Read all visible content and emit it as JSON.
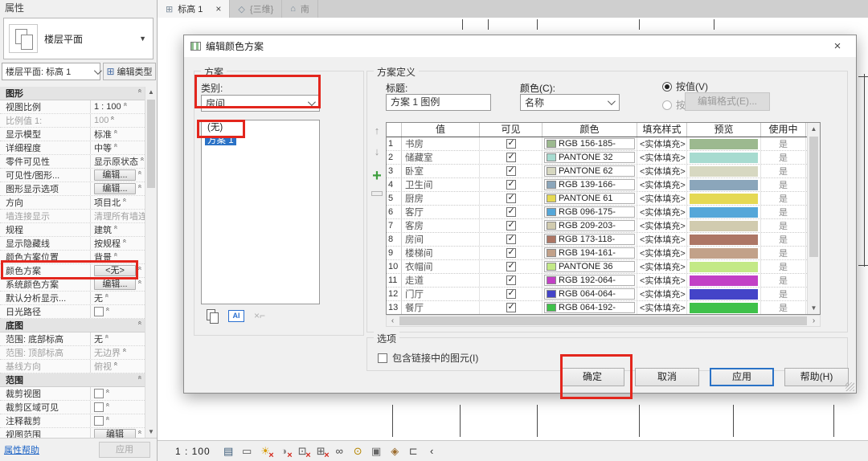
{
  "tabs": [
    {
      "label": "标高 1",
      "glyph": "⊞",
      "active": true
    },
    {
      "label": "{三维}",
      "glyph": "◇",
      "active": false
    },
    {
      "label": "南",
      "glyph": "⌂",
      "active": false
    }
  ],
  "properties": {
    "title": "属性",
    "type_name": "楼层平面",
    "instance": "楼层平面: 标高 1",
    "edit_type": "编辑类型",
    "rows": [
      {
        "label": "图形",
        "value": "",
        "kind": "section"
      },
      {
        "label": "视图比例",
        "value": "1 : 100",
        "kind": "text"
      },
      {
        "label": "比例值 1:",
        "value": "100",
        "kind": "text mute"
      },
      {
        "label": "显示模型",
        "value": "标准",
        "kind": "text"
      },
      {
        "label": "详细程度",
        "value": "中等",
        "kind": "text"
      },
      {
        "label": "零件可见性",
        "value": "显示原状态",
        "kind": "text"
      },
      {
        "label": "可见性/图形...",
        "value": "编辑...",
        "kind": "button"
      },
      {
        "label": "图形显示选项",
        "value": "编辑...",
        "kind": "button"
      },
      {
        "label": "方向",
        "value": "项目北",
        "kind": "text"
      },
      {
        "label": "墙连接显示",
        "value": "清理所有墙连接",
        "kind": "text mute"
      },
      {
        "label": "规程",
        "value": "建筑",
        "kind": "text"
      },
      {
        "label": "显示隐藏线",
        "value": "按规程",
        "kind": "text"
      },
      {
        "label": "颜色方案位置",
        "value": "背景",
        "kind": "text"
      },
      {
        "label": "颜色方案",
        "value": "<无>",
        "kind": "button hl"
      },
      {
        "label": "系统颜色方案",
        "value": "编辑...",
        "kind": "button"
      },
      {
        "label": "默认分析显示...",
        "value": "无",
        "kind": "text"
      },
      {
        "label": "日光路径",
        "value": "",
        "kind": "check"
      },
      {
        "label": "底图",
        "value": "",
        "kind": "section"
      },
      {
        "label": "范围: 底部标高",
        "value": "无",
        "kind": "text"
      },
      {
        "label": "范围: 顶部标高",
        "value": "无边界",
        "kind": "text mute"
      },
      {
        "label": "基线方向",
        "value": "俯视",
        "kind": "text mute"
      },
      {
        "label": "范围",
        "value": "",
        "kind": "section"
      },
      {
        "label": "裁剪视图",
        "value": "",
        "kind": "check"
      },
      {
        "label": "裁剪区域可见",
        "value": "",
        "kind": "check"
      },
      {
        "label": "注释裁剪",
        "value": "",
        "kind": "check"
      },
      {
        "label": "视图范围",
        "value": "编辑",
        "kind": "button"
      }
    ],
    "help_link": "属性帮助",
    "apply_label": "应用"
  },
  "dialog": {
    "title": "编辑颜色方案",
    "scheme": {
      "group_label": "方案",
      "category_label": "类别:",
      "category_value": "房间",
      "list": [
        {
          "label": "(无)",
          "selected": false
        },
        {
          "label": "方案 1",
          "selected": true
        }
      ]
    },
    "definition": {
      "group_label": "方案定义",
      "title_label": "标题:",
      "title_value": "方案 1 图例",
      "color_label": "颜色(C):",
      "color_value": "名称",
      "by_value_label": "按值(V)",
      "by_range_label": "按范围(G)",
      "edit_format_label": "编辑格式(E)..."
    },
    "table": {
      "headers": {
        "num": "",
        "value": "值",
        "visible": "可见",
        "color": "颜色",
        "fill": "填充样式",
        "preview": "预览",
        "in_use": "使用中"
      },
      "rows": [
        {
          "num": "1",
          "value": "书房",
          "color": "RGB 156-185-",
          "fill": "<实体填充>",
          "in_use": "是",
          "hex": "#9cb98f"
        },
        {
          "num": "2",
          "value": "储藏室",
          "color": "PANTONE 32",
          "fill": "<实体填充>",
          "in_use": "是",
          "hex": "#a7dbd0"
        },
        {
          "num": "3",
          "value": "卧室",
          "color": "PANTONE 62",
          "fill": "<实体填充>",
          "in_use": "是",
          "hex": "#d7d8c1"
        },
        {
          "num": "4",
          "value": "卫生间",
          "color": "RGB 139-166-",
          "fill": "<实体填充>",
          "in_use": "是",
          "hex": "#8ba6bb"
        },
        {
          "num": "5",
          "value": "厨房",
          "color": "PANTONE 61",
          "fill": "<实体填充>",
          "in_use": "是",
          "hex": "#e5d954"
        },
        {
          "num": "6",
          "value": "客厅",
          "color": "RGB 096-175-",
          "fill": "<实体填充>",
          "in_use": "是",
          "hex": "#55a7d9"
        },
        {
          "num": "7",
          "value": "客房",
          "color": "RGB 209-203-",
          "fill": "<实体填充>",
          "in_use": "是",
          "hex": "#d1cbaf"
        },
        {
          "num": "8",
          "value": "房间",
          "color": "RGB 173-118-",
          "fill": "<实体填充>",
          "in_use": "是",
          "hex": "#ad7665"
        },
        {
          "num": "9",
          "value": "楼梯间",
          "color": "RGB 194-161-",
          "fill": "<实体填充>",
          "in_use": "是",
          "hex": "#c2a189"
        },
        {
          "num": "10",
          "value": "衣帽间",
          "color": "PANTONE 36",
          "fill": "<实体填充>",
          "in_use": "是",
          "hex": "#c3e987"
        },
        {
          "num": "11",
          "value": "走道",
          "color": "RGB 192-064-",
          "fill": "<实体填充>",
          "in_use": "是",
          "hex": "#c240c6"
        },
        {
          "num": "12",
          "value": "门厅",
          "color": "RGB 064-064-",
          "fill": "<实体填充>",
          "in_use": "是",
          "hex": "#4444c8"
        },
        {
          "num": "13",
          "value": "餐厅",
          "color": "RGB 064-192-",
          "fill": "<实体填充>",
          "in_use": "是",
          "hex": "#3fc14a"
        }
      ]
    },
    "options": {
      "group_label": "选项",
      "include_linked_label": "包含链接中的图元(I)"
    },
    "buttons": {
      "ok": "确定",
      "cancel": "取消",
      "apply": "应用",
      "help": "帮助(H)"
    }
  },
  "status_bar": {
    "scale": "1 : 100",
    "icons": [
      {
        "name": "visual-style-icon",
        "glyph": "▤",
        "color": "#3a5a78",
        "off": false
      },
      {
        "name": "detail-level-icon",
        "glyph": "▭",
        "color": "#555555",
        "off": false
      },
      {
        "name": "sun-path-icon",
        "glyph": "☀",
        "color": "#d69a00",
        "off": true
      },
      {
        "name": "shadows-icon",
        "glyph": "◑",
        "color": "#8a8a8a",
        "off": true
      },
      {
        "name": "crop-view-icon",
        "glyph": "⊡",
        "color": "#555555",
        "off": true
      },
      {
        "name": "crop-region-icon",
        "glyph": "⊞",
        "color": "#555555",
        "off": true
      },
      {
        "name": "temporary-hide-icon",
        "glyph": "∞",
        "color": "#444444",
        "off": false
      },
      {
        "name": "reveal-hidden-icon",
        "glyph": "⊙",
        "color": "#b58500",
        "off": false
      },
      {
        "name": "worksharing-display-icon",
        "glyph": "▣",
        "color": "#666666",
        "off": false
      },
      {
        "name": "analytical-model-icon",
        "glyph": "◈",
        "color": "#9a6a2a",
        "off": false
      },
      {
        "name": "constraints-icon",
        "glyph": "⊏",
        "color": "#555555",
        "off": false
      },
      {
        "name": "collapse-arrow-icon",
        "glyph": "‹",
        "color": "#333333",
        "off": false
      }
    ]
  }
}
